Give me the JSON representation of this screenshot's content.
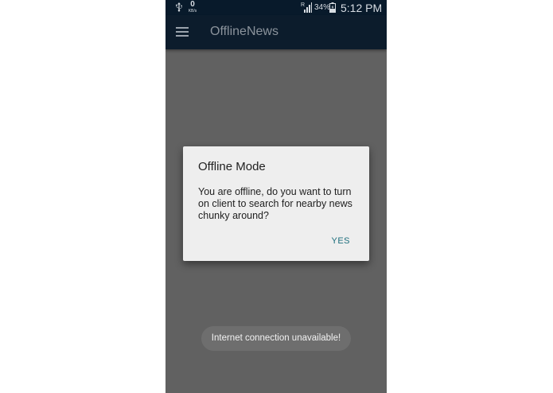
{
  "status_bar": {
    "usb_icon": "usb-icon",
    "net_speed_value": "0",
    "net_speed_unit": "KB/s",
    "signal_icon": "signal-icon",
    "signal_badge": "R",
    "battery_percent": "34%",
    "battery_icon": "battery-charging-icon",
    "time": "5:12 PM"
  },
  "app_bar": {
    "menu_icon": "hamburger-menu-icon",
    "title": "OfflineNews"
  },
  "dialog": {
    "title": "Offline Mode",
    "message": "You are offline, do you want to turn on client to search for nearby news chunky around?",
    "confirm_label": "YES"
  },
  "toast": {
    "text": "Internet connection unavailable!"
  },
  "colors": {
    "status_bar_bg": "#081a2b",
    "app_bar_bg": "#0c1c2c",
    "scrim": "#616161",
    "dialog_bg": "#eeeeee",
    "accent": "#1c6e7c"
  }
}
